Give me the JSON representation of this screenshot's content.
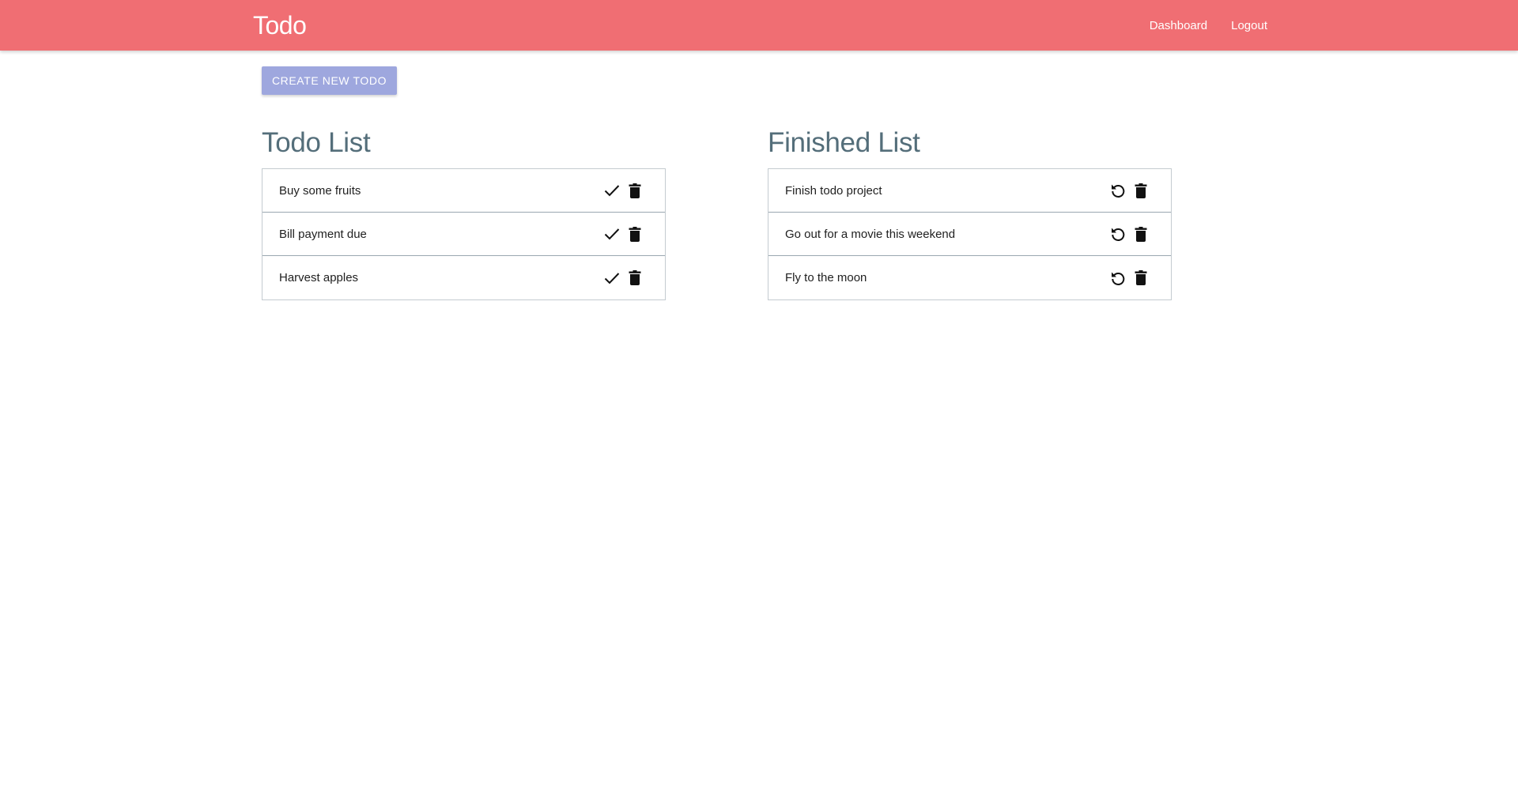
{
  "navbar": {
    "brand": "Todo",
    "links": [
      {
        "label": "Dashboard"
      },
      {
        "label": "Logout"
      }
    ],
    "color": "#f06e73"
  },
  "actions": {
    "create_label": "CREATE NEW TODO",
    "button_color": "#9ea7de"
  },
  "todo_list": {
    "title": "Todo List",
    "items": [
      {
        "text": "Buy some fruits",
        "icons": [
          "check-icon",
          "trash-icon"
        ]
      },
      {
        "text": "Bill payment due",
        "icons": [
          "check-icon",
          "trash-icon"
        ]
      },
      {
        "text": "Harvest apples",
        "icons": [
          "check-icon",
          "trash-icon"
        ]
      }
    ]
  },
  "finished_list": {
    "title": "Finished List",
    "items": [
      {
        "text": "Finish todo project",
        "icons": [
          "undo-icon",
          "trash-icon"
        ]
      },
      {
        "text": "Go out for a movie this weekend",
        "icons": [
          "undo-icon",
          "trash-icon"
        ]
      },
      {
        "text": "Fly to the moon",
        "icons": [
          "undo-icon",
          "trash-icon"
        ]
      }
    ]
  }
}
